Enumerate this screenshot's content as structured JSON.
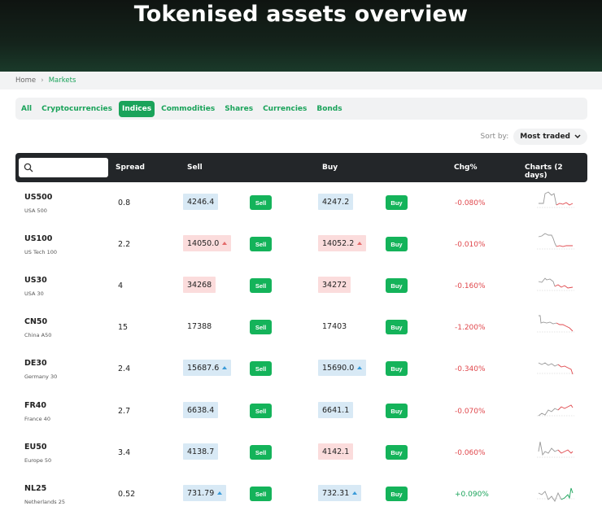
{
  "hero": {
    "title": "Tokenised assets overview"
  },
  "breadcrumb": {
    "home": "Home",
    "current": "Markets"
  },
  "tabs": [
    "All",
    "Cryptocurrencies",
    "Indices",
    "Commodities",
    "Shares",
    "Currencies",
    "Bonds"
  ],
  "selected_tab": "Indices",
  "sort": {
    "label": "Sort by:",
    "value": "Most traded"
  },
  "table": {
    "search_placeholder": "",
    "headers": {
      "spread": "Spread",
      "sell": "Sell",
      "buy": "Buy",
      "chg": "Chg%",
      "charts": "Charts (2 days)"
    },
    "sell_label": "Sell",
    "buy_label": "Buy",
    "rows": [
      {
        "symbol": "US500",
        "name": "USA 500",
        "spread": "0.8",
        "sell": "4246.4",
        "sell_style": "blue",
        "sell_arrow": "",
        "buy": "4247.2",
        "buy_style": "blue",
        "buy_arrow": "",
        "chg": "-0.080%",
        "chg_dir": "down"
      },
      {
        "symbol": "US100",
        "name": "US Tech 100",
        "spread": "2.2",
        "sell": "14050.0",
        "sell_style": "red",
        "sell_arrow": "up",
        "buy": "14052.2",
        "buy_style": "red",
        "buy_arrow": "up",
        "chg": "-0.010%",
        "chg_dir": "down"
      },
      {
        "symbol": "US30",
        "name": "USA 30",
        "spread": "4",
        "sell": "34268",
        "sell_style": "red",
        "sell_arrow": "",
        "buy": "34272",
        "buy_style": "red",
        "buy_arrow": "",
        "chg": "-0.160%",
        "chg_dir": "down"
      },
      {
        "symbol": "CN50",
        "name": "China A50",
        "spread": "15",
        "sell": "17388",
        "sell_style": "none",
        "sell_arrow": "",
        "buy": "17403",
        "buy_style": "none",
        "buy_arrow": "",
        "chg": "-1.200%",
        "chg_dir": "down"
      },
      {
        "symbol": "DE30",
        "name": "Germany 30",
        "spread": "2.4",
        "sell": "15687.6",
        "sell_style": "blue",
        "sell_arrow": "up",
        "buy": "15690.0",
        "buy_style": "blue",
        "buy_arrow": "up",
        "chg": "-0.340%",
        "chg_dir": "down"
      },
      {
        "symbol": "FR40",
        "name": "France 40",
        "spread": "2.7",
        "sell": "6638.4",
        "sell_style": "blue",
        "sell_arrow": "",
        "buy": "6641.1",
        "buy_style": "blue",
        "buy_arrow": "",
        "chg": "-0.070%",
        "chg_dir": "down"
      },
      {
        "symbol": "EU50",
        "name": "Europe 50",
        "spread": "3.4",
        "sell": "4138.7",
        "sell_style": "blue",
        "sell_arrow": "",
        "buy": "4142.1",
        "buy_style": "red",
        "buy_arrow": "",
        "chg": "-0.060%",
        "chg_dir": "down"
      },
      {
        "symbol": "NL25",
        "name": "Netherlands 25",
        "spread": "0.52",
        "sell": "731.79",
        "sell_style": "blue",
        "sell_arrow": "up",
        "buy": "732.31",
        "buy_style": "blue",
        "buy_arrow": "up",
        "chg": "+0.090%",
        "chg_dir": "up"
      }
    ]
  },
  "colors": {
    "accent": "#1aa35a",
    "down": "#e0474c",
    "up": "#1aa35a",
    "header_bg": "#232629"
  },
  "icons": {
    "search": "search-icon",
    "sort": "chevron-down-icon",
    "breadcrumb_sep": "chevron-right-icon",
    "price_up": "triangle-up-icon"
  }
}
